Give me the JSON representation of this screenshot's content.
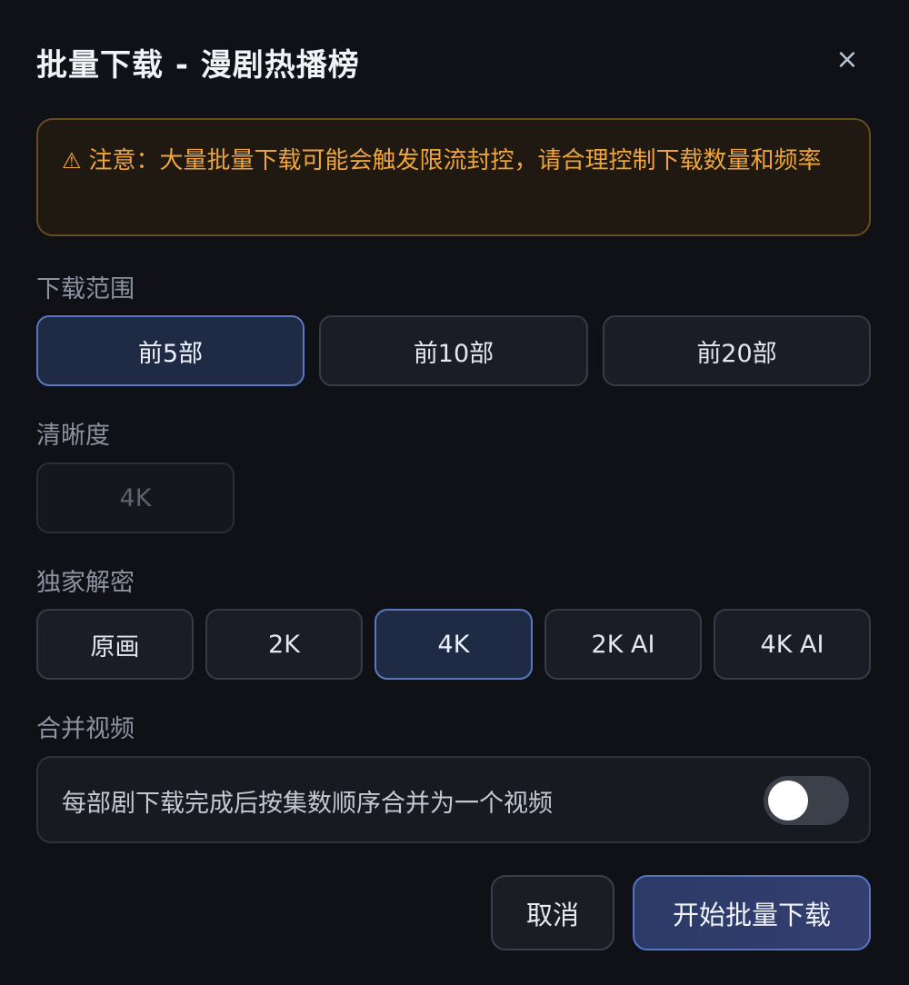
{
  "dialog": {
    "title": "批量下载 - 漫剧热播榜",
    "close_label": "×"
  },
  "warning": {
    "icon": "warning-triangle-icon",
    "icon_glyph": "⚠",
    "text": "注意：大量批量下载可能会触发限流封控，请合理控制下载数量和频率"
  },
  "range": {
    "label": "下载范围",
    "options": [
      "前5部",
      "前10部",
      "前20部"
    ],
    "selected": "前5部"
  },
  "clarity": {
    "label": "清晰度",
    "options": [
      "4K"
    ],
    "disabled": true
  },
  "decrypt": {
    "label": "独家解密",
    "options": [
      "原画",
      "2K",
      "4K",
      "2K AI",
      "4K AI"
    ],
    "selected": "4K"
  },
  "merge": {
    "label": "合并视频",
    "description": "每部剧下载完成后按集数顺序合并为一个视频",
    "enabled": false
  },
  "actions": {
    "cancel_label": "取消",
    "start_label": "开始批量下载"
  },
  "colors": {
    "warning": "#f0a53a",
    "accent": "#5b77bf",
    "background": "#0f1117"
  }
}
